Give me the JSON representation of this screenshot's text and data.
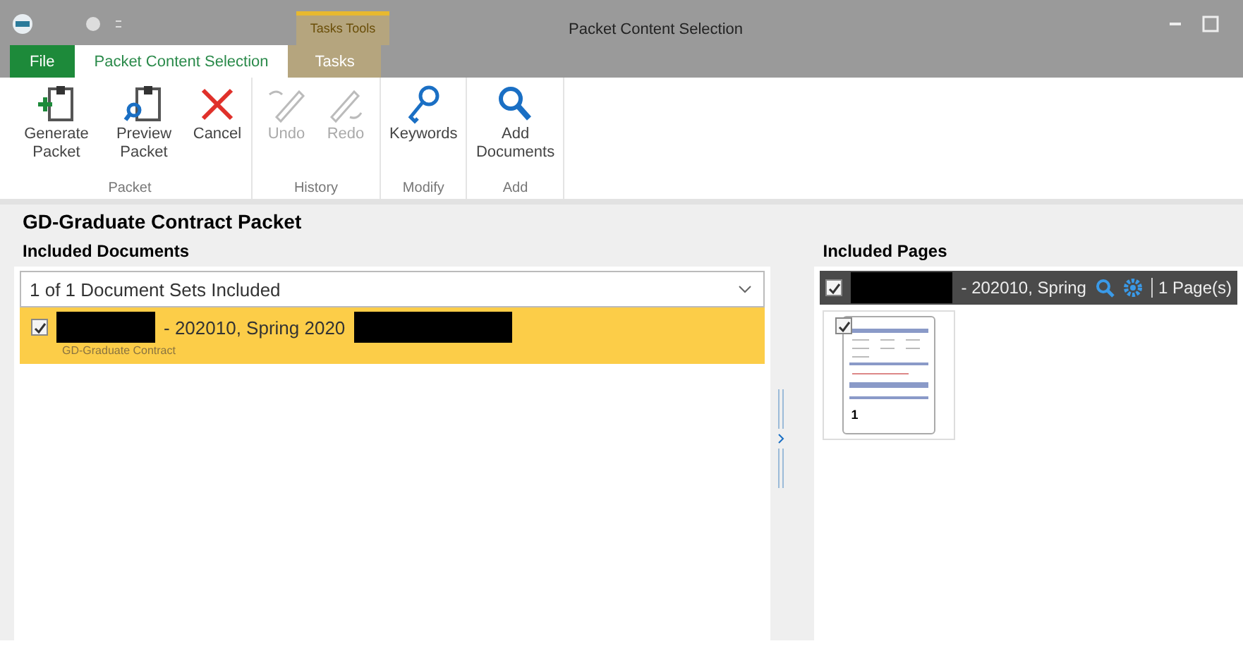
{
  "window": {
    "title": "Packet Content Selection"
  },
  "tool_tab_group": "Tasks Tools",
  "tabs": [
    {
      "label": "File",
      "kind": "file",
      "selected": false
    },
    {
      "label": "Packet Content Selection",
      "kind": "normal",
      "selected": true
    },
    {
      "label": "Tasks",
      "kind": "tool",
      "selected": false
    }
  ],
  "ribbon_groups": [
    {
      "label": "Packet",
      "buttons": [
        {
          "label": "Generate Packet",
          "kind": "generate",
          "disabled": false
        },
        {
          "label": "Preview Packet",
          "kind": "preview",
          "disabled": false
        },
        {
          "label": "Cancel",
          "kind": "cancel",
          "disabled": false
        }
      ]
    },
    {
      "label": "History",
      "buttons": [
        {
          "label": "Undo",
          "kind": "undo",
          "disabled": true
        },
        {
          "label": "Redo",
          "kind": "redo",
          "disabled": true
        }
      ]
    },
    {
      "label": "Modify",
      "buttons": [
        {
          "label": "Keywords",
          "kind": "keys",
          "disabled": false
        }
      ]
    },
    {
      "label": "Add",
      "buttons": [
        {
          "label": "Add Documents",
          "kind": "search",
          "disabled": false
        }
      ]
    }
  ],
  "packet_title": "GD-Graduate Contract Packet",
  "included_documents": {
    "heading": "Included Documents",
    "filter": "1 of 1 Document Sets Included",
    "rows": [
      {
        "selected": true,
        "checked": true,
        "title": "- 202010, Spring 2020",
        "subtitle": "GD-Graduate Contract"
      }
    ]
  },
  "included_pages": {
    "heading": "Included Pages",
    "checked": true,
    "title": "- 202010, Spring",
    "count": "1 Page(s)",
    "pages": [
      {
        "number": "1",
        "checked": true
      }
    ]
  }
}
